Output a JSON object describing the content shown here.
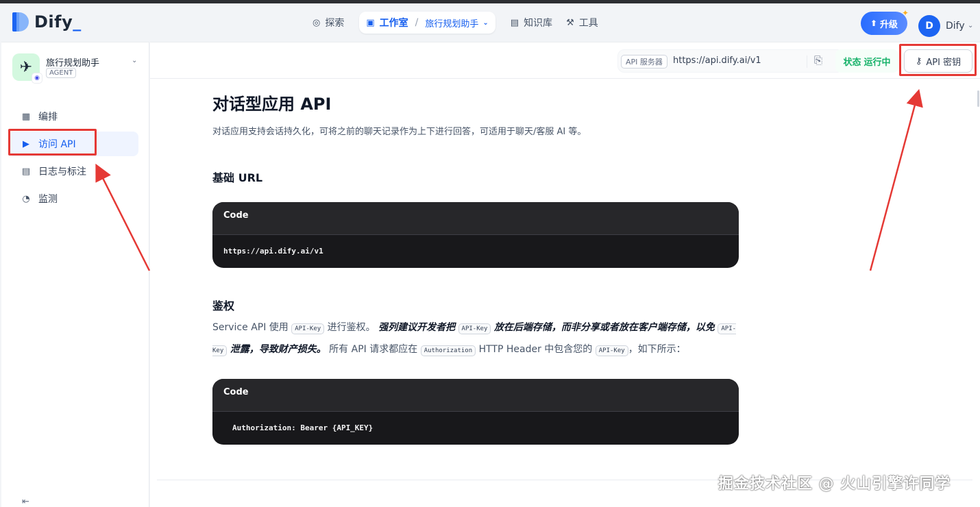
{
  "header": {
    "logo_text": "Dify",
    "nav": {
      "explore": "探索",
      "studio": "工作室",
      "separator": "/",
      "current_app": "旅行规划助手",
      "knowledge": "知识库",
      "tools": "工具"
    },
    "upgrade_label": "升级",
    "user_initial": "D",
    "user_name": "Dify"
  },
  "sidebar": {
    "app_name": "旅行规划助手",
    "app_type": "AGENT",
    "items": [
      {
        "label": "编排",
        "icon": "layout-icon"
      },
      {
        "label": "访问 API",
        "icon": "terminal-icon",
        "active": true
      },
      {
        "label": "日志与标注",
        "icon": "file-list-icon"
      },
      {
        "label": "监测",
        "icon": "dashboard-icon"
      }
    ]
  },
  "toolbar": {
    "api_server_tag": "API 服务器",
    "api_server_url": "https://api.dify.ai/v1",
    "status_label": "状态",
    "status_value": "运行中",
    "api_key_label": "API 密钥"
  },
  "doc": {
    "title": "对话型应用 API",
    "subtitle": "对话应用支持会话持久化，可将之前的聊天记录作为上下进行回答，可适用于聊天/客服 AI 等。",
    "base_url": {
      "heading": "基础 URL",
      "code_label": "Code",
      "code": "https://api.dify.ai/v1"
    },
    "auth": {
      "heading": "鉴权",
      "p1": "Service API 使用",
      "code_apikey": "API-Key",
      "p2": "进行鉴权。",
      "em1": "强列建议开发者把",
      "em2": "放在后端存储，而非分享或者放在客户端存储，以免",
      "em3": "泄露，导致财产损失。",
      "p3": "所有 API 请求都应在",
      "code_authorization": "Authorization",
      "p4": "HTTP Header 中包含您的",
      "p5": "，如下所示：",
      "code_label": "Code",
      "code": "Authorization: Bearer {API_KEY}"
    }
  },
  "watermark": "掘金技术社区 @ 火山引擎许同学",
  "colors": {
    "accent": "#155eef",
    "status_green": "#17b26a",
    "annotation_red": "#e53935",
    "code_bg": "#18181b"
  }
}
